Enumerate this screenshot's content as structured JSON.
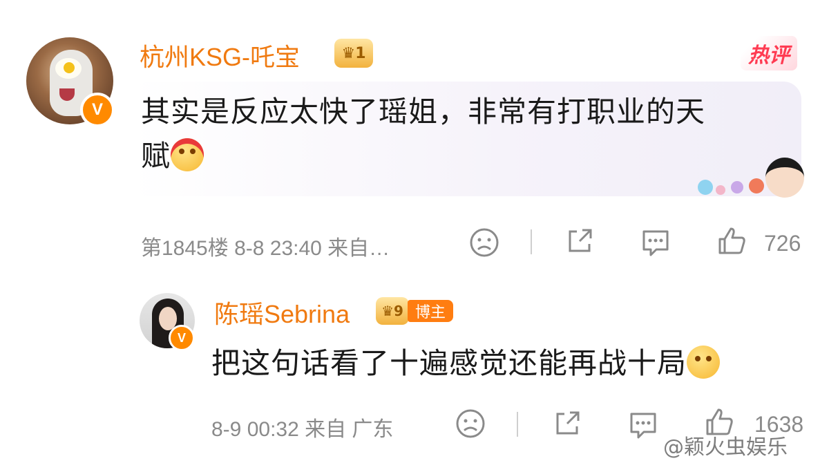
{
  "main_comment": {
    "username": "杭州KSG-吒宝",
    "crown_level": "1",
    "hot_tag": "热评",
    "text": "其实是反应太快了瑶姐，非常有打职业的天赋",
    "text_line1": "其实是反应太快了瑶姐，非常有打职业的天",
    "text_line2": "赋",
    "verified_badge": "V",
    "floor_time_source": "第1845楼  8-8  23:40  来自…",
    "likes": "726",
    "icons": [
      "unhappy-face-icon",
      "share-icon",
      "comment-icon",
      "thumbs-up-icon"
    ]
  },
  "reply": {
    "username": "陈瑶Sebrina",
    "crown_level": "9",
    "blogger_tag": "博主",
    "text": "把这句话看了十遍感觉还能再战十局",
    "verified_badge": "V",
    "time_source": "8-9  00:32  来自  广东",
    "likes": "1638",
    "icons": [
      "unhappy-face-icon",
      "share-icon",
      "comment-icon",
      "thumbs-up-icon"
    ]
  },
  "watermark": "@颖火虫娱乐",
  "colors": {
    "username": "#f07a10",
    "badge": "#ff8a00",
    "hot_tag": "#ff3b52",
    "meta": "#8a8a8a"
  }
}
